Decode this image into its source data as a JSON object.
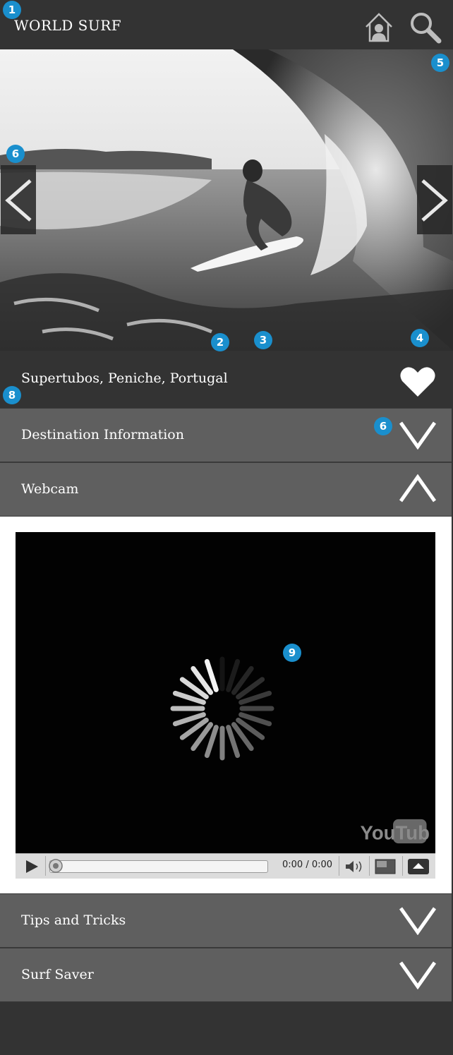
{
  "header": {
    "title": "WORLD SURF",
    "home_icon": "home-user-icon",
    "search_icon": "search-icon"
  },
  "hero": {
    "prev_icon": "chevron-left-icon",
    "next_icon": "chevron-right-icon"
  },
  "location": {
    "name": "Supertubos, Peniche, Portugal",
    "favorite_icon": "heart-icon"
  },
  "sections": [
    {
      "label": "Destination Information",
      "state": "collapsed"
    },
    {
      "label": "Webcam",
      "state": "expanded"
    },
    {
      "label": "Tips and Tricks",
      "state": "collapsed"
    },
    {
      "label": "Surf Saver",
      "state": "collapsed"
    }
  ],
  "video": {
    "time": "0:00 / 0:00",
    "logo": "YouTube",
    "loading_icon": "loading-spinner-icon"
  },
  "markers": [
    "1",
    "2",
    "3",
    "4",
    "5",
    "6",
    "6",
    "8",
    "9"
  ],
  "colors": {
    "header_bg": "#333333",
    "accordion_bg": "#5f5f5f",
    "marker": "#1a8fcd"
  }
}
